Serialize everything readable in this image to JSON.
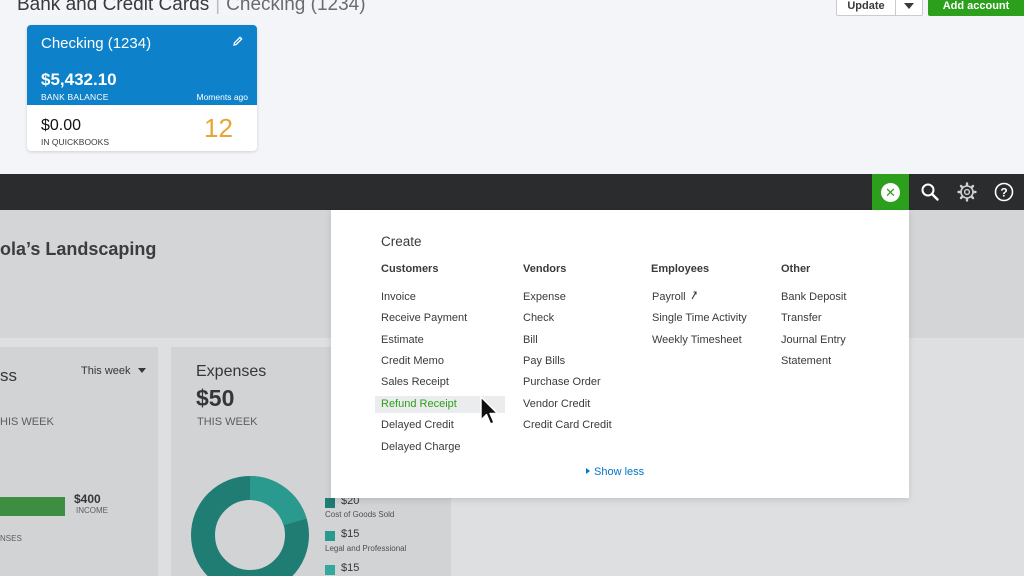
{
  "header": {
    "title": "Bank and Credit Cards",
    "subtitle": "Checking (1234)",
    "update_label": "Update",
    "add_account_label": "Add account"
  },
  "account_card": {
    "name": "Checking (1234)",
    "bank_balance": "$5,432.10",
    "bank_balance_label": "BANK BALANCE",
    "updated": "Moments ago",
    "qb_balance": "$0.00",
    "qb_label": "IN QUICKBOOKS",
    "count": "12"
  },
  "navbar": {
    "icons": [
      "close-icon",
      "search-icon",
      "gear-icon",
      "help-icon"
    ],
    "accent": "#2ca01c"
  },
  "dashboard": {
    "company_name": "ola’s Landscaping",
    "left_card": {
      "title": "ss",
      "period": "This week",
      "subtitle": "HIS WEEK",
      "income_value": "$400",
      "income_label": "INCOME",
      "bottom_label": "NSES"
    },
    "expenses": {
      "title": "Expenses",
      "total": "$50",
      "period": "THIS WEEK",
      "legend": [
        {
          "value": "$20",
          "label": "Cost of Goods Sold"
        },
        {
          "value": "$15",
          "label": "Legal and Professional"
        },
        {
          "value": "$15",
          "label": ""
        }
      ]
    }
  },
  "create_menu": {
    "title": "Create",
    "columns": [
      {
        "heading": "Customers",
        "items": [
          "Invoice",
          "Receive Payment",
          "Estimate",
          "Credit Memo",
          "Sales Receipt",
          "Refund Receipt",
          "Delayed Credit",
          "Delayed Charge"
        ]
      },
      {
        "heading": "Vendors",
        "items": [
          "Expense",
          "Check",
          "Bill",
          "Pay Bills",
          "Purchase Order",
          "Vendor Credit",
          "Credit Card Credit"
        ]
      },
      {
        "heading": "Employees",
        "items": [
          "Payroll",
          "Single Time Activity",
          "Weekly Timesheet"
        ]
      },
      {
        "heading": "Other",
        "items": [
          "Bank Deposit",
          "Transfer",
          "Journal Entry",
          "Statement"
        ]
      }
    ],
    "highlighted": "Refund Receipt",
    "show_less": "Show less"
  },
  "colors": {
    "brand_green": "#2ca01c",
    "account_blue": "#0d81c9",
    "count_orange": "#e8a531",
    "link_blue": "#0077c5",
    "teal": "#1f8c82"
  }
}
